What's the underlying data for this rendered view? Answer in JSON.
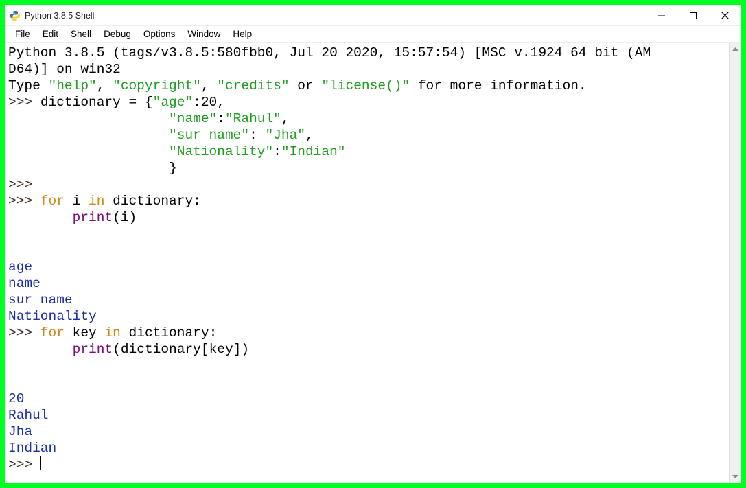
{
  "window": {
    "title": "Python 3.8.5 Shell"
  },
  "menu": {
    "items": [
      "File",
      "Edit",
      "Shell",
      "Debug",
      "Options",
      "Window",
      "Help"
    ]
  },
  "shell": {
    "banner1": "Python 3.8.5 (tags/v3.8.5:580fbb0, Jul 20 2020, 15:57:54) [MSC v.1924 64 bit (AM",
    "banner2": "D64)] on win32",
    "banner3_a": "Type ",
    "banner3_b": "\"help\"",
    "banner3_c": ", ",
    "banner3_d": "\"copyright\"",
    "banner3_e": ", ",
    "banner3_f": "\"credits\"",
    "banner3_g": " or ",
    "banner3_h": "\"license()\"",
    "banner3_i": " for more information.",
    "prompt": ">>> ",
    "prompt_bare": ">>>",
    "dict_line_a": "dictionary = {",
    "k_age": "\"age\"",
    "colon": ":",
    "v_age": "20",
    "comma": ",",
    "indent_keys": "                    ",
    "k_name": "\"name\"",
    "v_name": "\"Rahul\"",
    "k_sur": "\"sur name\"",
    "colon_sp": ": ",
    "v_sur": "\"Jha\"",
    "k_nat": "\"Nationality\"",
    "v_nat": "\"Indian\"",
    "indent_close": "                    }",
    "kw_for": "for",
    "sp": " ",
    "var_i": "i",
    "var_key": "key",
    "kw_in": "in",
    "dict_colon": " dictionary:",
    "indent_body": "        ",
    "print": "print",
    "lp": "(",
    "rp": ")",
    "arg_i": "i",
    "arg_dk_a": "dictionary[key]",
    "out_age": "age",
    "out_name": "name",
    "out_sur": "sur name",
    "out_nat": "Nationality",
    "out_20": "20",
    "out_rahul": "Rahul",
    "out_jha": "Jha",
    "out_indian": "Indian"
  }
}
